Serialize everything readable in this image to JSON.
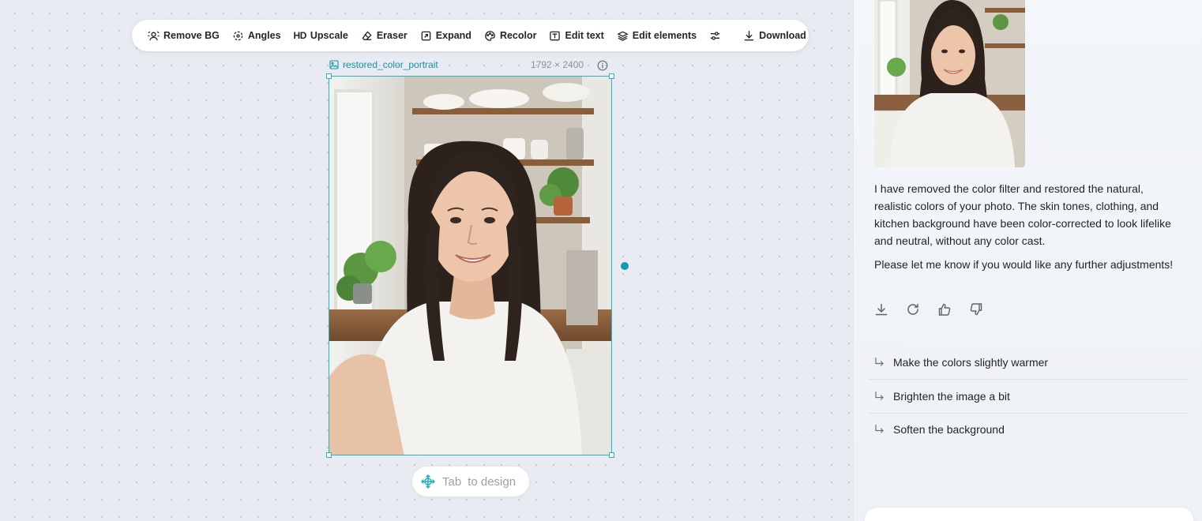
{
  "toolbar": {
    "items": [
      {
        "label": "Remove BG",
        "icon": "remove-bg-icon"
      },
      {
        "label": "Angles",
        "icon": "angles-icon"
      },
      {
        "label": "Upscale",
        "icon": "hd-icon",
        "glyph": "HD"
      },
      {
        "label": "Eraser",
        "icon": "eraser-icon"
      },
      {
        "label": "Expand",
        "icon": "expand-icon"
      },
      {
        "label": "Recolor",
        "icon": "recolor-icon"
      },
      {
        "label": "Edit text",
        "icon": "edit-text-icon"
      },
      {
        "label": "Edit elements",
        "icon": "layers-icon"
      }
    ],
    "download_label": "Download"
  },
  "canvas": {
    "image_name": "restored_color_portrait",
    "image_dims": "1792 × 2400",
    "tab_key": "Tab",
    "tab_hint": "to design"
  },
  "chat": {
    "message_p1": "I have removed the color filter and restored the natural, realistic colors of your photo. The skin tones, clothing, and kitchen background have been color-corrected to look lifelike and neutral, without any color cast.",
    "message_p2": "Please let me know if you would like any further adjustments!",
    "suggestions": [
      "Make the colors slightly warmer",
      "Brighten the image a bit",
      "Soften the background"
    ]
  },
  "colors": {
    "accent": "#2bb3c4",
    "accent_dark": "#1399b0",
    "panel_bg": "#f3f6fb",
    "canvas_bg": "#e8ecf2"
  }
}
